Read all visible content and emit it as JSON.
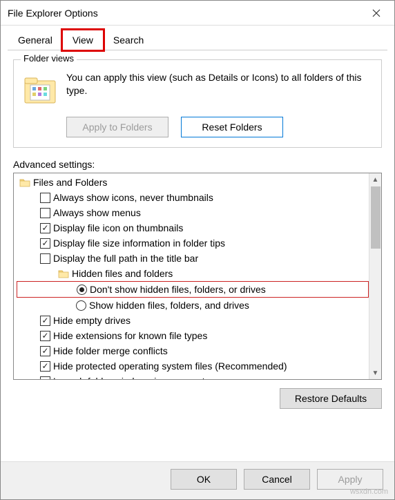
{
  "window": {
    "title": "File Explorer Options"
  },
  "tabs": {
    "general": "General",
    "view": "View",
    "search": "Search",
    "active": "view"
  },
  "folder_views": {
    "legend": "Folder views",
    "desc": "You can apply this view (such as Details or Icons) to all folders of this type.",
    "apply": "Apply to Folders",
    "reset": "Reset Folders"
  },
  "advanced": {
    "label": "Advanced settings:",
    "root": "Files and Folders",
    "items": [
      {
        "type": "check",
        "checked": false,
        "label": "Always show icons, never thumbnails"
      },
      {
        "type": "check",
        "checked": false,
        "label": "Always show menus"
      },
      {
        "type": "check",
        "checked": true,
        "label": "Display file icon on thumbnails"
      },
      {
        "type": "check",
        "checked": true,
        "label": "Display file size information in folder tips"
      },
      {
        "type": "check",
        "checked": false,
        "label": "Display the full path in the title bar"
      },
      {
        "type": "group",
        "label": "Hidden files and folders",
        "children": [
          {
            "type": "radio",
            "selected": true,
            "label": "Don't show hidden files, folders, or drives",
            "hl": true
          },
          {
            "type": "radio",
            "selected": false,
            "label": "Show hidden files, folders, and drives"
          }
        ]
      },
      {
        "type": "check",
        "checked": true,
        "label": "Hide empty drives"
      },
      {
        "type": "check",
        "checked": true,
        "label": "Hide extensions for known file types"
      },
      {
        "type": "check",
        "checked": true,
        "label": "Hide folder merge conflicts"
      },
      {
        "type": "check",
        "checked": true,
        "label": "Hide protected operating system files (Recommended)"
      },
      {
        "type": "check",
        "checked": false,
        "label": "Launch folder windows in a separate process"
      }
    ]
  },
  "buttons": {
    "restore": "Restore Defaults",
    "ok": "OK",
    "cancel": "Cancel",
    "apply": "Apply"
  },
  "watermark": "wsxdn.com"
}
